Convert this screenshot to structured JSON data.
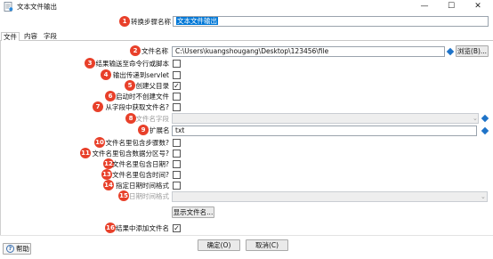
{
  "window": {
    "title": "文本文件输出",
    "minimize": "—",
    "maximize": "☐",
    "close": "✕"
  },
  "badges": [
    "1",
    "2",
    "3",
    "4",
    "5",
    "6",
    "7",
    "8",
    "9",
    "10",
    "11",
    "12",
    "13",
    "14",
    "15",
    "16"
  ],
  "step_name": {
    "label": "转换步骤名称",
    "value": "文本文件输出"
  },
  "tabs": [
    "文件",
    "内容",
    "字段"
  ],
  "fields": {
    "filename": {
      "label": "文件名称",
      "value": "C:\\Users\\kuangshougang\\Desktop\\123456\\file",
      "browse": "浏览(B)..."
    },
    "pass_to_servlet_cmd": {
      "label": "结果输送至命令行或脚本",
      "checked": false
    },
    "pass_to_servlet": {
      "label": "输出传递到servlet",
      "checked": false
    },
    "create_parent": {
      "label": "创建父目录",
      "checked": true,
      "check_mark": "✓"
    },
    "no_create_on_start": {
      "label": "启动时不创建文件",
      "checked": false
    },
    "filename_from_field": {
      "label": "从字段中获取文件名?",
      "checked": false
    },
    "filename_field": {
      "label": "文件名字段",
      "value": ""
    },
    "extension": {
      "label": "扩展名",
      "value": "txt"
    },
    "include_stepnr": {
      "label": "文件名里包含步骤数?",
      "checked": false
    },
    "include_partnr": {
      "label": "文件名里包含数据分区号?",
      "checked": false
    },
    "include_date": {
      "label": "文件名里包含日期?",
      "checked": false
    },
    "include_time": {
      "label": "文件名里包含时间?",
      "checked": false
    },
    "specify_format": {
      "label": "指定日期时间格式",
      "checked": false
    },
    "date_format": {
      "label": "日期时间格式",
      "value": ""
    },
    "show_filename": "显示文件名...",
    "add_to_result": {
      "label": "结果中添加文件名",
      "checked": true,
      "check_mark": "✓"
    }
  },
  "footer": {
    "help": "帮助",
    "help_icon_glyph": "?",
    "ok": "确定(O)",
    "cancel": "取消(C)"
  },
  "colors": {
    "badge": "#e8402a",
    "selection": "#0078d7",
    "variable_diamond": "#1e73c8"
  }
}
